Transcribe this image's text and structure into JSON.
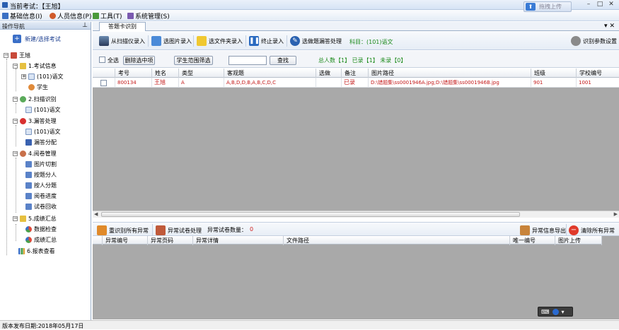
{
  "window": {
    "title": "当前考试：【王旭】"
  },
  "menu": [
    {
      "label": "基础信息(I)",
      "icon": "info-icon",
      "color": "#3a6fc4"
    },
    {
      "label": "人员信息(P)",
      "icon": "people-icon",
      "color": "#d05a2a"
    },
    {
      "label": "工具(T)",
      "icon": "tools-icon",
      "color": "#4a9a3a"
    },
    {
      "label": "系统管理(S)",
      "icon": "system-icon",
      "color": "#7a5ab0"
    }
  ],
  "upload": {
    "label": "拖拽上传"
  },
  "nav": {
    "header": "操作导航",
    "new_exam": "新建/选择考试",
    "root": "王旭",
    "items": {
      "exam_info": "1.考试信息",
      "exam_info_subject": "(101)语文",
      "student": "学生",
      "scan": "2.扫描识别",
      "scan_subject": "(101)语文",
      "omission": "3.漏答处理",
      "omission_subject": "(101)语文",
      "omission_assign": "漏答分配",
      "grading": "4.阅卷管理",
      "grading_cut": "图片切割",
      "grading_by_question": "按题分人",
      "grading_by_person": "按人分题",
      "grading_progress": "阅卷进度",
      "grading_recycle": "试卷回收",
      "scores": "5.成绩汇总",
      "scores_check": "数据检查",
      "scores_summary": "成绩汇总",
      "report": "6.报表查看"
    }
  },
  "tabs": {
    "card": "答题卡识别"
  },
  "toolbar": {
    "scan": "从扫描仪录入",
    "image": "选图片录入",
    "folder": "选文件夹录入",
    "stop": "终止录入",
    "omission": "选做题漏答处理",
    "subject": "科目：(101)语文",
    "settings": "识别参数设置"
  },
  "filter": {
    "select_all": "全选",
    "delete": "删除选中项",
    "range": "学生范围筛选",
    "search_placeholder": "",
    "search_btn": "查找",
    "summary": "总人数【1】 已录【1】 未录【0】"
  },
  "grid": {
    "columns": [
      "考号",
      "姓名",
      "类型",
      "客观题",
      "选做",
      "备注",
      "图片路径",
      "班级",
      "学校编号"
    ],
    "rows": [
      {
        "id": "800134",
        "name": "王旭",
        "type": "A",
        "objective": "A,B,D,D,B,A,B,C,D,C",
        "optional": "",
        "note": "已录",
        "path": "D:\\错题集\\ss0001946A.jpg;D:\\错题集\\ss0001946B.jpg",
        "class": "901",
        "school": "1001"
      }
    ]
  },
  "errbar": {
    "reidentify": "重识别所有异常",
    "handle": "异常试卷处理",
    "count_label": "异常试卷数量：",
    "count": "0",
    "export": "异常信息导出",
    "clear": "清除所有异常"
  },
  "errgrid": {
    "columns": [
      "异常编号",
      "异常页码",
      "异常详情",
      "文件路径",
      "唯一编号",
      "图片上传"
    ]
  },
  "status": {
    "release": "版本发布日期:2018年05月17日"
  }
}
